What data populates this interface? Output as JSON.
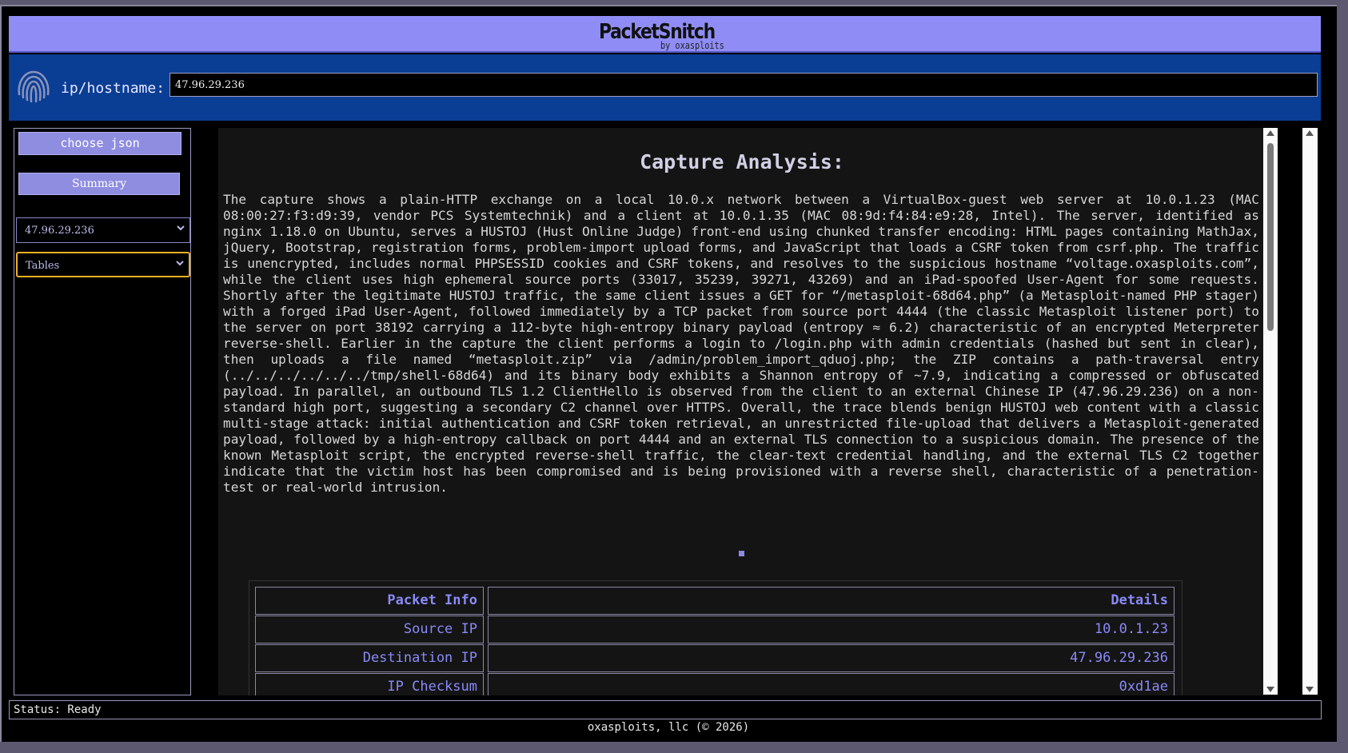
{
  "header": {
    "title": "PacketSnitch",
    "subtitle": "by oxasploits"
  },
  "ipbar": {
    "label": "ip/hostname:",
    "value": "47.96.29.236"
  },
  "sidebar": {
    "choose_json_label": "choose json",
    "summary_label": "Summary",
    "ip_select_value": "47.96.29.236",
    "view_select_value": "Tables"
  },
  "content": {
    "title": "Capture Analysis:",
    "analysis": "The capture shows a plain-HTTP exchange on a local 10.0.x network between a VirtualBox-guest web server at 10.0.1.23 (MAC 08:00:27:f3:d9:39, vendor PCS Systemtechnik) and a client at 10.0.1.35 (MAC 08:9d:f4:84:e9:28, Intel). The server, identified as nginx 1.18.0 on Ubuntu, serves a HUSTOJ (Hust Online Judge) front-end using chunked transfer encoding: HTML pages containing MathJax, jQuery, Bootstrap, registration forms, problem-import upload forms, and JavaScript that loads a CSRF token from csrf.php. The traffic is unencrypted, includes normal PHPSESSID cookies and CSRF tokens, and resolves to the suspicious hostname “voltage.oxasploits.com”, while the client uses high ephemeral source ports (33017, 35239, 39271, 43269) and an iPad-spoofed User-Agent for some requests. Shortly after the legitimate HUSTOJ traffic, the same client issues a GET for “/metasploit-68d64.php” (a Metasploit-named PHP stager) with a forged iPad User-Agent, followed immediately by a TCP packet from source port 4444 (the classic Metasploit listener port) to the server on port 38192 carrying a 112-byte high-entropy binary payload (entropy ≈ 6.2) characteristic of an encrypted Meterpreter reverse-shell. Earlier in the capture the client performs a login to /login.php with admin credentials (hashed but sent in clear), then uploads a file named “metasploit.zip” via /admin/problem_import_qduoj.php; the ZIP contains a path-traversal entry (../../../../../../tmp/shell-68d64) and its binary body exhibits a Shannon entropy of ~7.9, indicating a compressed or obfuscated payload. In parallel, an outbound TLS 1.2 ClientHello is observed from the client to an external Chinese IP (47.96.29.236) on a non-standard high port, suggesting a secondary C2 channel over HTTPS. Overall, the trace blends benign HUSTOJ web content with a classic multi-stage attack: initial authentication and CSRF token retrieval, an unrestricted file-upload that delivers a Metasploit-generated payload, followed by a high-entropy callback on port 4444 and an external TLS connection to a suspicious domain. The presence of the known Metasploit script, the encrypted reverse-shell traffic, the clear-text credential handling, and the external TLS C2 together indicate that the victim host has been compromised and is being provisioned with a reverse shell, characteristic of a penetration-test or real-world intrusion.",
    "table": {
      "headers": [
        "Packet Info",
        "Details"
      ],
      "rows": [
        [
          "Source IP",
          "10.0.1.23"
        ],
        [
          "Destination IP",
          "47.96.29.236"
        ],
        [
          "IP Checksum",
          "0xd1ae"
        ]
      ]
    }
  },
  "status": "Status: Ready",
  "footer": "oxasploits, llc (© 2026)"
}
